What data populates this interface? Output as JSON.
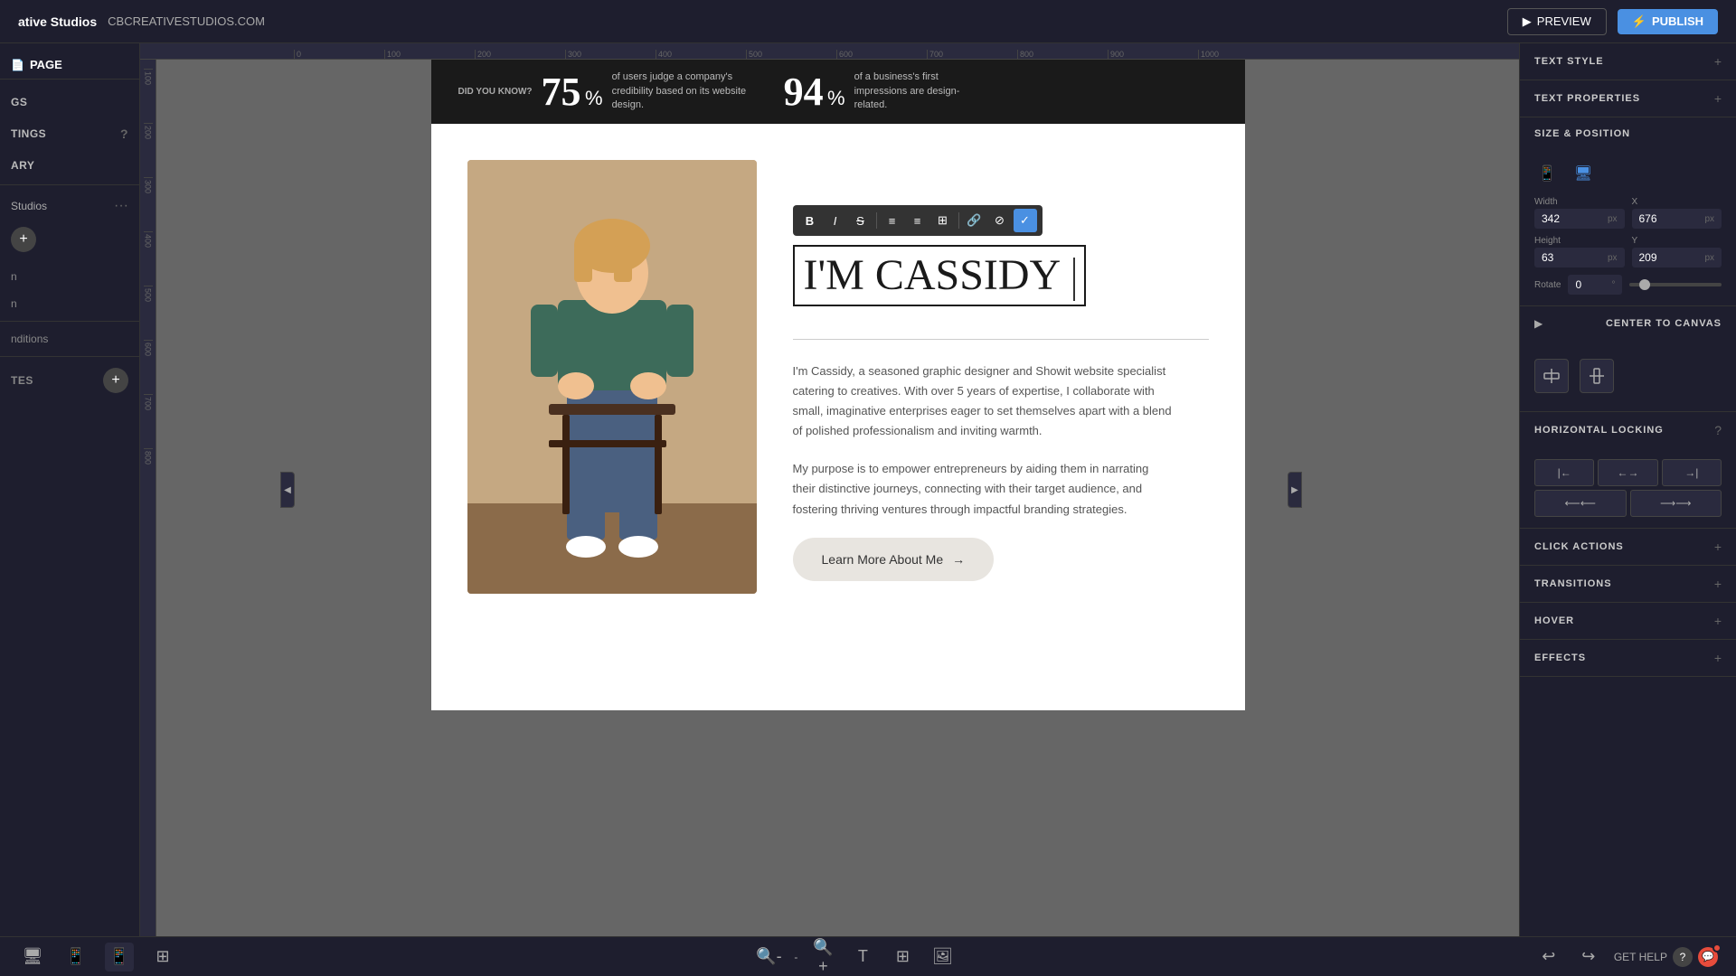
{
  "topbar": {
    "brand": "ative Studios",
    "url": "CBCREATIVESTUDIOS.COM",
    "preview_label": "PREVIEW",
    "publish_label": "PUBLISH"
  },
  "left_sidebar": {
    "page_label": "PAGE",
    "items": [
      {
        "id": "gs",
        "label": "GS"
      },
      {
        "id": "tings",
        "label": "TINGS"
      },
      {
        "id": "ary",
        "label": "ARY"
      }
    ],
    "project_name": "Studios",
    "nav_items": [
      {
        "label": "n"
      },
      {
        "label": "n"
      }
    ],
    "bottom_items": [
      {
        "label": "nditions"
      }
    ],
    "templates_label": "TES"
  },
  "canvas": {
    "stats": [
      {
        "label": "DID YOU KNOW?",
        "number": "75",
        "suffix": "%",
        "description": "of users judge a company's credibility based on its website design."
      },
      {
        "number": "94",
        "suffix": "%",
        "description": "of a business's first impressions are design-related."
      }
    ],
    "about": {
      "heading": "I'M CASSIDY",
      "cursor_visible": true,
      "paragraph1": "I'm Cassidy, a seasoned graphic designer and Showit website specialist catering to creatives. With over 5 years of expertise, I collaborate with small, imaginative enterprises eager to set themselves apart with a blend of polished professionalism and inviting warmth.",
      "paragraph2": "My purpose is to empower entrepreneurs by aiding them in narrating their distinctive journeys, connecting with their target audience, and fostering thriving ventures through impactful branding strategies.",
      "button_label": "Learn More About Me",
      "button_arrow": "→"
    }
  },
  "text_toolbar": {
    "buttons": [
      "B",
      "I",
      "S",
      "≡",
      "≡",
      "≡",
      "⊞",
      "🔗",
      "⊘",
      "✓"
    ]
  },
  "right_panel": {
    "text_style_label": "TEXT STYLE",
    "text_style_plus": "+",
    "text_properties_label": "TEXT PROPERTIES",
    "text_properties_plus": "+",
    "size_position_label": "SIZE & POSITION",
    "width_label": "Width",
    "width_value": "342",
    "width_unit": "px",
    "x_label": "X",
    "x_value": "676",
    "x_unit": "px",
    "height_label": "Height",
    "height_value": "63",
    "height_unit": "px",
    "y_label": "Y",
    "y_value": "209",
    "y_unit": "px",
    "rotate_label": "Rotate",
    "rotate_value": "0",
    "rotate_unit": "°",
    "center_canvas_label": "CENTER TO CANVAS",
    "horizontal_locking_label": "HORIZONTAL LOCKING",
    "click_actions_label": "CLICK ACTIONS",
    "transitions_label": "TRANSITIONS",
    "hover_label": "HOVER",
    "effects_label": "EFFECTS"
  },
  "bottom_toolbar": {
    "get_help_label": "GET HELP",
    "undo_label": "↩",
    "redo_label": "↪"
  }
}
